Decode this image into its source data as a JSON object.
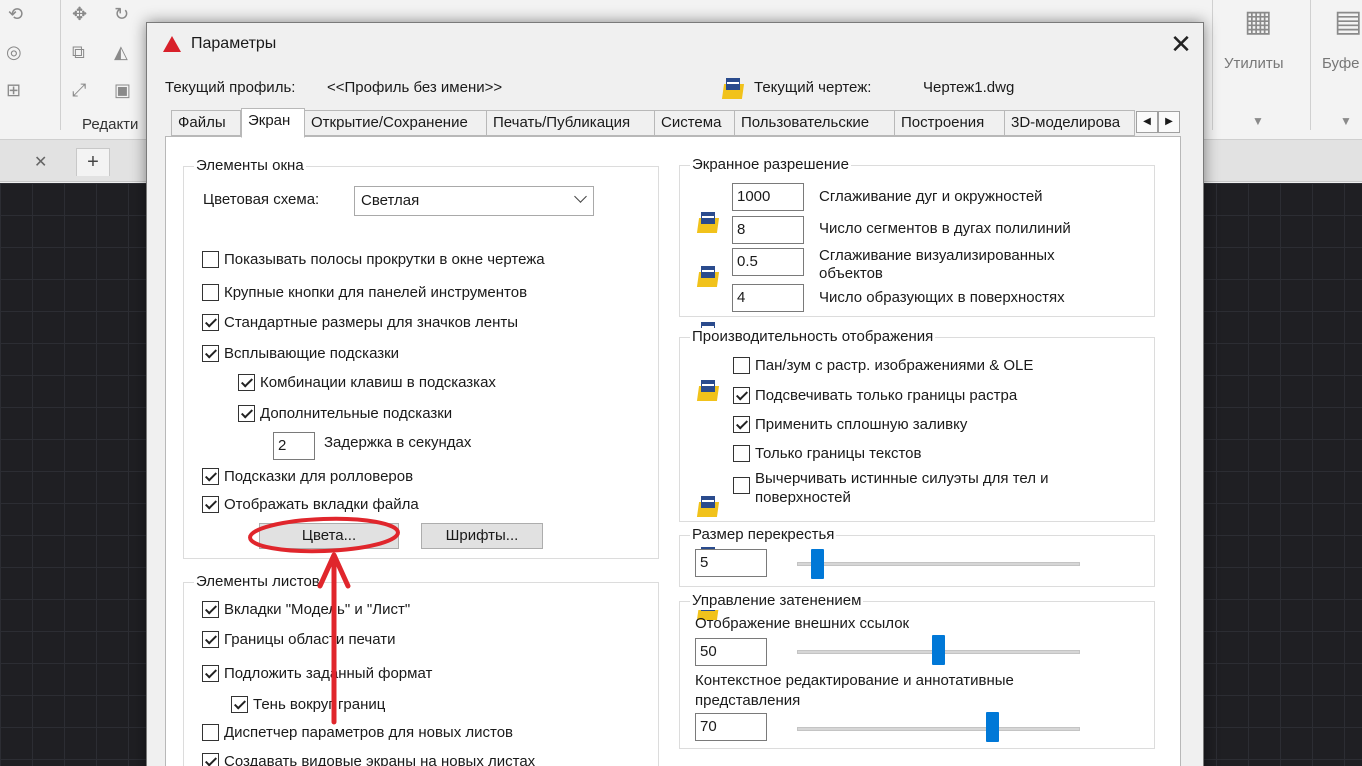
{
  "ribbon": {
    "panel_label": "Редакти",
    "utilities_label": "Утилиты",
    "buffer_label": "Буфе"
  },
  "dialog": {
    "title": "Параметры",
    "current_profile_label": "Текущий профиль:",
    "current_profile_value": "<<Профиль без имени>>",
    "current_drawing_label": "Текущий чертеж:",
    "current_drawing_value": "Чертеж1.dwg",
    "tabs": [
      {
        "label": "Файлы"
      },
      {
        "label": "Экран"
      },
      {
        "label": "Открытие/Сохранение"
      },
      {
        "label": "Печать/Публикация"
      },
      {
        "label": "Система"
      },
      {
        "label": "Пользовательские"
      },
      {
        "label": "Построения"
      },
      {
        "label": "3D-моделирова"
      }
    ],
    "active_tab": "Экран"
  },
  "window_elements": {
    "title": "Элементы окна",
    "color_scheme_label": "Цветовая схема:",
    "color_scheme_value": "Светлая",
    "options": [
      {
        "label": "Показывать полосы прокрутки в окне чертежа",
        "checked": false
      },
      {
        "label": "Крупные кнопки для панелей инструментов",
        "checked": false
      },
      {
        "label": "Стандартные размеры для значков ленты",
        "checked": true
      },
      {
        "label": "Всплывающие подсказки",
        "checked": true
      },
      {
        "label": "Комбинации клавиш в подсказках",
        "checked": true
      },
      {
        "label": "Дополнительные подсказки",
        "checked": true
      },
      {
        "label": "Подсказки для ролловеров",
        "checked": true
      },
      {
        "label": "Отображать вкладки файла",
        "checked": true
      }
    ],
    "delay_value": "2",
    "delay_label": "Задержка в секундах",
    "colors_button": "Цвета...",
    "fonts_button": "Шрифты..."
  },
  "layout_elements": {
    "title": "Элементы листов",
    "options": [
      {
        "label": "Вкладки \"Модель\" и \"Лист\"",
        "checked": true
      },
      {
        "label": "Границы области печати",
        "checked": true
      },
      {
        "label": "Подложить заданный формат",
        "checked": true
      },
      {
        "label": "Тень вокруг границ",
        "checked": true
      },
      {
        "label": "Диспетчер параметров для новых листов",
        "checked": false
      },
      {
        "label": "Создавать видовые экраны на новых листах",
        "checked": true
      }
    ]
  },
  "display_resolution": {
    "title": "Экранное разрешение",
    "rows": [
      {
        "value": "1000",
        "label": "Сглаживание дуг и окружностей"
      },
      {
        "value": "8",
        "label": "Число сегментов в дугах полилиний"
      },
      {
        "value": "0.5",
        "label": "Сглаживание визуализированных объектов"
      },
      {
        "value": "4",
        "label": "Число образующих в поверхностях"
      }
    ]
  },
  "display_performance": {
    "title": "Производительность отображения",
    "options": [
      {
        "label": "Пан/зум с растр. изображениями & OLE",
        "checked": false
      },
      {
        "label": "Подсвечивать только границы растра",
        "checked": true
      },
      {
        "label": "Применить сплошную заливку",
        "checked": true
      },
      {
        "label": "Только границы текстов",
        "checked": false
      },
      {
        "label": "Вычерчивать истинные силуэты для тел и поверхностей",
        "checked": false
      }
    ]
  },
  "crosshair": {
    "title": "Размер перекрестья",
    "value": "5",
    "slider_fraction": 0.05
  },
  "fade_control": {
    "title": "Управление затенением",
    "xref_label": "Отображение внешних ссылок",
    "xref_value": "50",
    "xref_fraction": 0.5,
    "inplace_label": "Контекстное редактирование и аннотативные представления",
    "inplace_value": "70",
    "inplace_fraction": 0.7
  },
  "colors": {
    "accent": "#0078d7",
    "annotation": "#e0262c",
    "autocad_red": "#d8202a"
  }
}
